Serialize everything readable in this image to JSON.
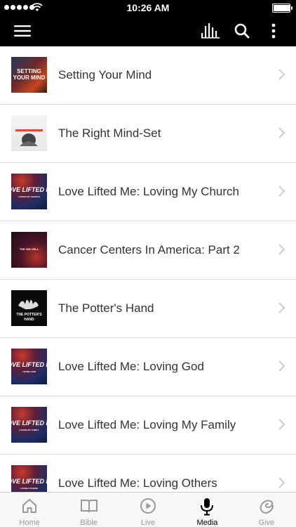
{
  "status_bar": {
    "time": "10:26 AM",
    "battery_level": 0.95
  },
  "nav_bar": {
    "icons": [
      "menu-icon",
      "audio-bars-icon",
      "search-icon",
      "more-vertical-icon"
    ]
  },
  "media_list": [
    {
      "title": "Setting Your Mind",
      "thumb_text": [
        "SETTING",
        "YOUR MIND"
      ],
      "style": "setting"
    },
    {
      "title": "The Right Mind-Set",
      "thumb_text": [],
      "style": "mindset"
    },
    {
      "title": "Love Lifted Me: Loving My Church",
      "thumb_text": [
        "OVE LIFTED M",
        "LOVING MY CHURCH"
      ],
      "style": "love"
    },
    {
      "title": "Cancer Centers In America: Part 2",
      "thumb_text": [
        "THE SIN CELL"
      ],
      "style": "cancer"
    },
    {
      "title": "The Potter's Hand",
      "thumb_text": [
        "THE POTTER'S",
        "HAND"
      ],
      "style": "potter"
    },
    {
      "title": "Love Lifted Me: Loving God",
      "thumb_text": [
        "OVE LIFTED M",
        "LOVING GOD"
      ],
      "style": "love"
    },
    {
      "title": "Love Lifted Me: Loving My Family",
      "thumb_text": [
        "OVE LIFTED M",
        "LOVING MY FAMILY"
      ],
      "style": "love"
    },
    {
      "title": "Love Lifted Me: Loving Others",
      "thumb_text": [
        "OVE LIFTED M",
        "LOVING OTHERS"
      ],
      "style": "love"
    }
  ],
  "tab_bar": {
    "active": "Media",
    "tabs": [
      {
        "label": "Home",
        "icon": "home-icon"
      },
      {
        "label": "Bible",
        "icon": "book-icon"
      },
      {
        "label": "Live",
        "icon": "play-circle-icon"
      },
      {
        "label": "Media",
        "icon": "microphone-icon"
      },
      {
        "label": "Give",
        "icon": "give-icon"
      }
    ]
  },
  "colors": {
    "bar": "#000000",
    "text": "#333333",
    "chevron": "#c7c7cc",
    "tab_inactive": "#999999",
    "tab_active": "#000000"
  }
}
